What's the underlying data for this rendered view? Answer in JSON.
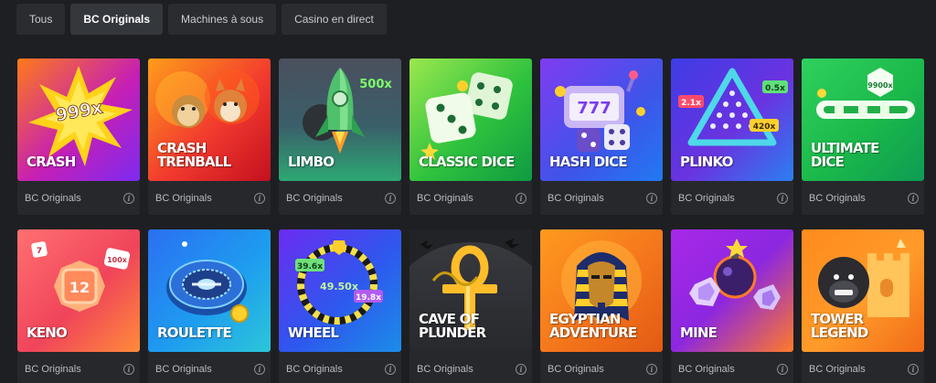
{
  "tabs": [
    {
      "label": "Tous",
      "active": false
    },
    {
      "label": "BC Originals",
      "active": true
    },
    {
      "label": "Machines à sous",
      "active": false
    },
    {
      "label": "Casino en direct",
      "active": false
    }
  ],
  "games": [
    {
      "title": "CRASH",
      "provider": "BC Originals",
      "badge": "999x"
    },
    {
      "title": "CRASH\nTRENBALL",
      "provider": "BC Originals"
    },
    {
      "title": "LIMBO",
      "provider": "BC Originals",
      "badge": "500x"
    },
    {
      "title": "CLASSIC DICE",
      "provider": "BC Originals"
    },
    {
      "title": "HASH DICE",
      "provider": "BC Originals",
      "badge": "777"
    },
    {
      "title": "PLINKO",
      "provider": "BC Originals",
      "badges": [
        "2.1x",
        "0.5x",
        "420x"
      ]
    },
    {
      "title": "ULTIMATE\nDICE",
      "provider": "BC Originals",
      "badge": "9900x"
    },
    {
      "title": "KENO",
      "provider": "BC Originals",
      "badges": [
        "7",
        "12",
        "100x"
      ]
    },
    {
      "title": "ROULETTE",
      "provider": "BC Originals"
    },
    {
      "title": "WHEEL",
      "provider": "BC Originals",
      "badges": [
        "39.6x",
        "49.50x",
        "19.8x"
      ]
    },
    {
      "title": "CAVE OF\nPLUNDER",
      "provider": "BC Originals"
    },
    {
      "title": "EGYPTIAN\nADVENTURE",
      "provider": "BC Originals"
    },
    {
      "title": "MINE",
      "provider": "BC Originals"
    },
    {
      "title": "TOWER\nLEGEND",
      "provider": "BC Originals"
    }
  ],
  "icons": {
    "info": "info-icon"
  }
}
